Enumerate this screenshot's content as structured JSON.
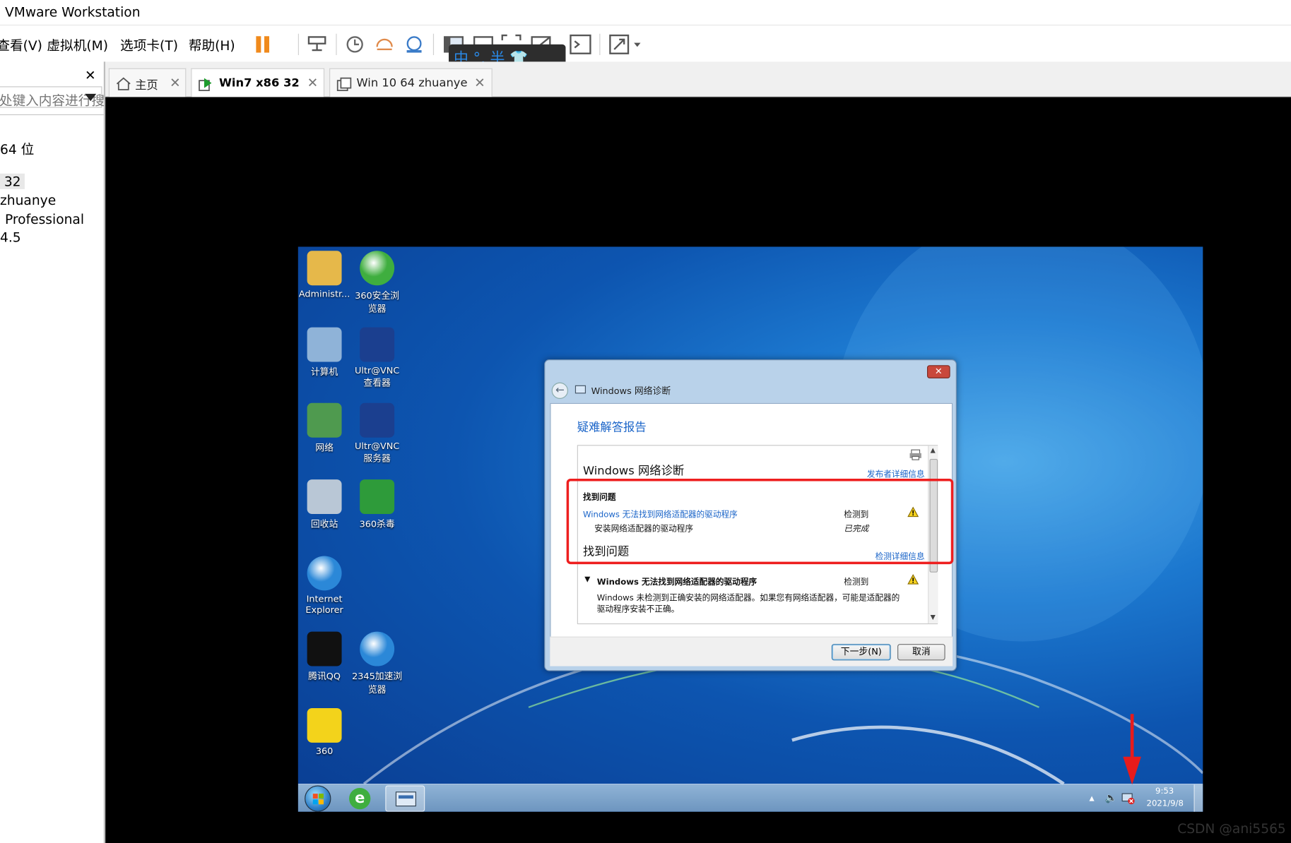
{
  "window": {
    "title": "VMware Workstation"
  },
  "menu": [
    "查看(V)",
    "虚拟机(M)",
    "选项卡(T)",
    "帮助(H)"
  ],
  "ime": {
    "label": "中 °, 半 👕"
  },
  "sidebar": {
    "close": "✕",
    "search_placeholder": "在此处键入内容进行搜索",
    "items": [
      "64 位",
      "32",
      "zhuanye",
      "Professional",
      "4.5"
    ]
  },
  "tabs": [
    {
      "label": "主页",
      "active": false
    },
    {
      "label": "Win7  x86  32",
      "active": true
    },
    {
      "label": "Win 10 64 zhuanye",
      "active": false
    }
  ],
  "desktop": {
    "icons": [
      {
        "label": "Administr...",
        "icon": "user-folder-icon",
        "color": "#e6b84a"
      },
      {
        "label": "360安全浏览器",
        "icon": "browser-360-icon",
        "color": "#3fae3f"
      },
      {
        "label": "计算机",
        "icon": "computer-icon",
        "color": "#8fb3d8"
      },
      {
        "label": "Ultr@VNC查看器",
        "icon": "vnc-viewer-icon",
        "color": "#1b3f8f"
      },
      {
        "label": "网络",
        "icon": "network-icon",
        "color": "#4f9a4f"
      },
      {
        "label": "Ultr@VNC服务器",
        "icon": "vnc-server-icon",
        "color": "#1b3f8f"
      },
      {
        "label": "回收站",
        "icon": "recycle-bin-icon",
        "color": "#b9c7d6"
      },
      {
        "label": "360杀毒",
        "icon": "antivirus-360-icon",
        "color": "#2e9b3a"
      },
      {
        "label": "Internet Explorer",
        "icon": "ie-icon",
        "color": "#2b88d8"
      },
      {
        "label": "腾讯QQ",
        "icon": "qq-icon",
        "color": "#111111"
      },
      {
        "label": "2345加速浏览器",
        "icon": "browser-2345-icon",
        "color": "#2b88d8"
      },
      {
        "label": "360",
        "icon": "app-360-icon",
        "color": "#f3d31b"
      }
    ]
  },
  "taskbar": {
    "time": "9:53",
    "date": "2021/9/8"
  },
  "dialog": {
    "title": "Windows 网络诊断",
    "heading": "疑难解答报告",
    "report_title": "Windows 网络诊断",
    "publisher_link": "发布者详细信息",
    "found_problem": "找到问题",
    "issue_link": "Windows 无法找到网络适配器的驱动程序",
    "issue_status": "检测到",
    "fix_text": "安装网络适配器的驱动程序",
    "fix_status": "已完成",
    "found_problem2": "找到问题",
    "detect_link": "检测详细信息",
    "detail_title": "Windows 无法找到网络适配器的驱动程序",
    "detail_status": "检测到",
    "detail_desc": "Windows 未检测到正确安装的网络适配器。如果您有网络适配器，可能是适配器的驱动程序安装不正确。",
    "next_button": "下一步(N)",
    "cancel_button": "取消"
  },
  "watermark": "CSDN @ani5565"
}
